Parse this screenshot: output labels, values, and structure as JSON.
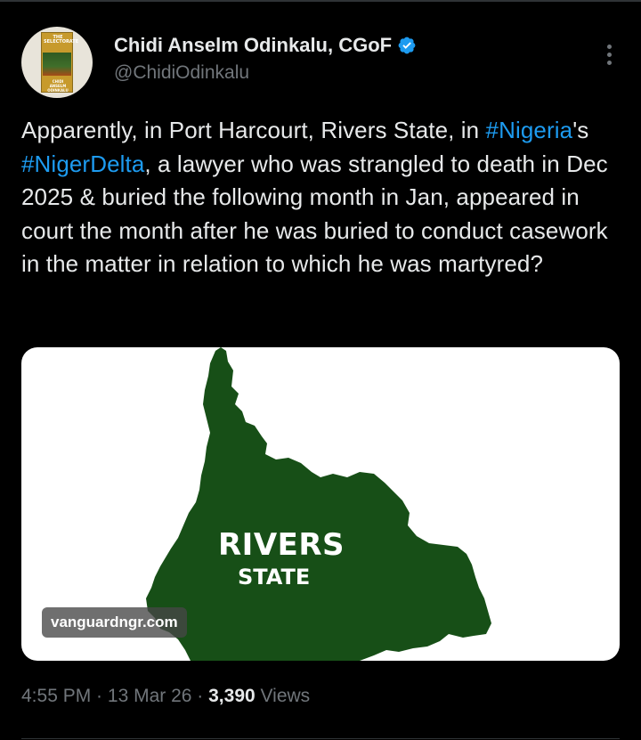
{
  "author": {
    "display_name": "Chidi Anselm Odinkalu, CGoF",
    "handle": "@ChidiOdinkalu",
    "avatar_book_title": "THE SELECTORATE",
    "avatar_book_author": "CHIDI ANSELM ODINKALU",
    "verified_icon": "verified-badge-icon",
    "verified_color": "#1d9bf0"
  },
  "more_icon": "more-options-icon",
  "tweet": {
    "segments": [
      {
        "text": "Apparently, in Port Harcourt, Rivers State, in ",
        "type": "text"
      },
      {
        "text": "#Nigeria",
        "type": "hashtag"
      },
      {
        "text": "'s ",
        "type": "text"
      },
      {
        "text": "#NigerDelta",
        "type": "hashtag"
      },
      {
        "text": ", a lawyer who was strangled to death in Dec 2025 & buried the following month in Jan, appeared in court the month after he was buried to conduct casework in the matter in relation to which he was martyred?",
        "type": "text"
      }
    ]
  },
  "media": {
    "map_label_line1": "RIVERS",
    "map_label_line2": "STATE",
    "map_color": "#174f17",
    "watermark": "vanguardngr.com"
  },
  "meta": {
    "time": "4:55 PM",
    "separator": " · ",
    "date": "13 Mar 26",
    "views_count": "3,390",
    "views_label": "Views"
  },
  "colors": {
    "background": "#000000",
    "text": "#e7e9ea",
    "secondary": "#71767b",
    "link": "#1d9bf0"
  }
}
